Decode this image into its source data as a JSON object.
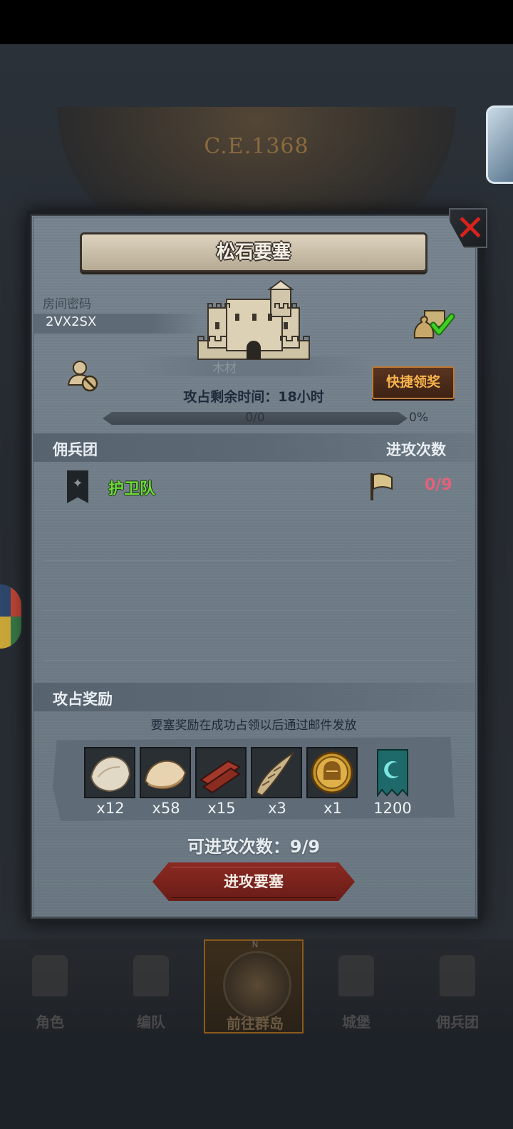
{
  "background": {
    "era": "C.E.1368"
  },
  "bottom_nav": {
    "items": [
      {
        "label": "角色"
      },
      {
        "label": "编队"
      },
      {
        "label": "前往群岛",
        "active": true
      },
      {
        "label": "城堡"
      },
      {
        "label": "佣兵团"
      }
    ],
    "compass_letter": "N"
  },
  "dialog": {
    "title": "松石要塞",
    "room": {
      "label": "房间密码",
      "code": "2VX2SX"
    },
    "resource_label": "木材",
    "quick_claim": "快捷领奖",
    "occupy_time": "攻占剩余时间：18小时",
    "progress": {
      "text": "0/0",
      "percent_text": "0%",
      "fraction": 0
    },
    "mercenary_header": "佣兵团",
    "attack_count_header": "进攻次数",
    "mercenaries": [
      {
        "name": "护卫队",
        "attacks": "0/9"
      }
    ],
    "rewards_header": "攻占奖励",
    "rewards_note": "要塞奖励在成功占领以后通过邮件发放",
    "rewards": [
      {
        "icon": "fur-pelt-icon",
        "qty": "x12"
      },
      {
        "icon": "wool-hide-icon",
        "qty": "x58"
      },
      {
        "icon": "wood-planks-icon",
        "qty": "x15"
      },
      {
        "icon": "horn-icon",
        "qty": "x3"
      },
      {
        "icon": "knight-helmet-coin-icon",
        "qty": "x1"
      },
      {
        "icon": "banner-moon-icon",
        "qty": "1200"
      }
    ],
    "attacks_left": "可进攻次数：9/9",
    "attack_button": "进攻要塞"
  },
  "colors": {
    "merc_name": "#6bdc3a",
    "attack_count": "#e2627c",
    "quick_button_text": "#f6b24c",
    "close_x": "#d8221c",
    "attack_button": "#8a2a22"
  }
}
